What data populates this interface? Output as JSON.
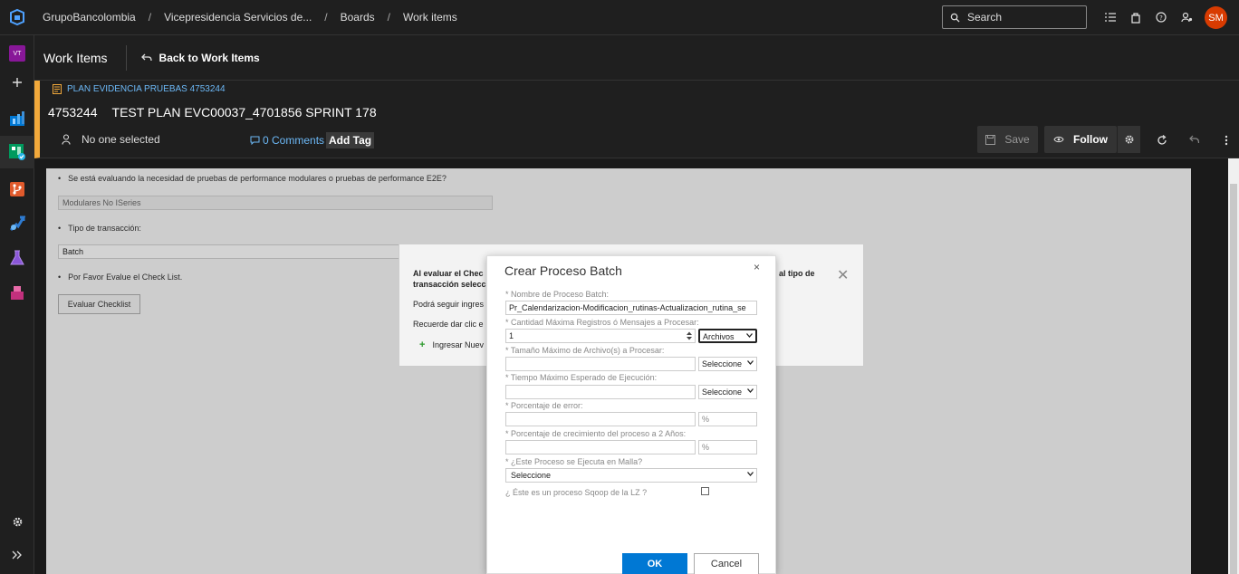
{
  "breadcrumb": {
    "items": [
      "GrupoBancolombia",
      "Vicepresidencia Servicios de...",
      "Boards",
      "Work items"
    ],
    "separator": "/"
  },
  "search": {
    "placeholder": "Search"
  },
  "user": {
    "initials": "SM",
    "color": "#d83b01"
  },
  "rail": {
    "project_badge": "VT"
  },
  "header": {
    "title": "Work Items",
    "back_label": "Back to Work Items"
  },
  "work_item": {
    "type_label": "PLAN EVIDENCIA PRUEBAS 4753244",
    "id": "4753244",
    "title": "TEST PLAN EVC00037_4701856 SPRINT 178",
    "assigned": "No one selected",
    "comments": "0 Comments",
    "add_tag": "Add Tag",
    "save_label": "Save",
    "follow_label": "Follow",
    "accent_color": "#f2a93b"
  },
  "form": {
    "q1": "Se está evaluando la necesidad de pruebas de performance modulares o pruebas de performance E2E?",
    "q1_value": "Modulares No ISeries",
    "q2": "Tipo de transacción:",
    "q2_value": "Batch",
    "q3": "Por Favor Evalue el Check List.",
    "checklist_button": "Evaluar Checklist"
  },
  "notice": {
    "line1_start": "Al evaluar el Chec",
    "line1_end": "al tipo de",
    "line2": "transacción selecc",
    "line3": "Podrá seguir ingres",
    "line4": "Recuerde dar clic e",
    "add_label": "Ingresar Nuev"
  },
  "dialog": {
    "title": "Crear Proceso Batch",
    "close": "×",
    "fields": {
      "name_label": "* Nombre de Proceso Batch:",
      "name_value": "Pr_Calendarizacion-Modificacion_rutinas-Actualizacion_rutina_se",
      "max_records_label": "* Cantidad Máxima Registros ó Mensajes a Procesar:",
      "max_records_value": "1",
      "max_records_unit": "Archivos",
      "file_size_label": "* Tamaño Máximo de Archivo(s) a Procesar:",
      "file_size_unit": "Seleccione",
      "exec_time_label": "* Tiempo Máximo Esperado de Ejecución:",
      "exec_time_unit": "Seleccione",
      "error_pct_label": "* Porcentaje de error:",
      "error_pct_unit": "%",
      "growth_pct_label": "* Porcentaje de crecimiento del proceso a 2 Años:",
      "growth_pct_unit": "%",
      "malla_label": "* ¿Este Proceso se Ejecuta en Malla?",
      "malla_value": "Seleccione",
      "sqoop_label": "¿ Éste es un proceso Sqoop de la LZ ?"
    },
    "ok_label": "OK",
    "cancel_label": "Cancel",
    "primary_color": "#0078d4"
  }
}
